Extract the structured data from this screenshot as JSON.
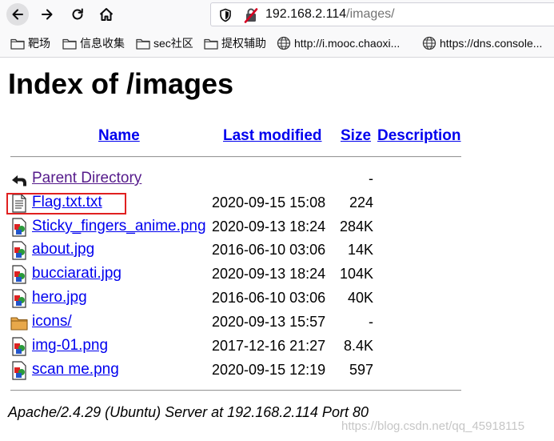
{
  "browser": {
    "address": {
      "host": "192.168.2.114",
      "path": "/images/"
    }
  },
  "bookmarks": [
    {
      "label": "靶场",
      "icon": "folder-icon"
    },
    {
      "label": "信息收集",
      "icon": "folder-icon"
    },
    {
      "label": "sec社区",
      "icon": "folder-icon"
    },
    {
      "label": "提权辅助",
      "icon": "folder-icon"
    },
    {
      "label": "http://i.mooc.chaoxi...",
      "icon": "globe-icon"
    },
    {
      "label": "https://dns.console...",
      "icon": "globe-icon"
    }
  ],
  "page": {
    "title": "Index of /images",
    "columns": {
      "name": "Name",
      "last_modified": "Last modified",
      "size": "Size",
      "description": "Description"
    },
    "entries": [
      {
        "name": "Parent Directory",
        "date": "",
        "size": "-",
        "icon": "back-arrow-icon"
      },
      {
        "name": "Flag.txt.txt",
        "date": "2020-09-15 15:08",
        "size": "224",
        "icon": "text-file-icon",
        "highlighted": true
      },
      {
        "name": "Sticky_fingers_anime.png",
        "date": "2020-09-13 18:24",
        "size": "284K",
        "icon": "image-file-icon"
      },
      {
        "name": "about.jpg",
        "date": "2016-06-10 03:06",
        "size": "14K",
        "icon": "image-file-icon"
      },
      {
        "name": "bucciarati.jpg",
        "date": "2020-09-13 18:24",
        "size": "104K",
        "icon": "image-file-icon"
      },
      {
        "name": "hero.jpg",
        "date": "2016-06-10 03:06",
        "size": "40K",
        "icon": "image-file-icon"
      },
      {
        "name": "icons/",
        "date": "2020-09-13 15:57",
        "size": "-",
        "icon": "folder-icon"
      },
      {
        "name": "img-01.png",
        "date": "2017-12-16 21:27",
        "size": "8.4K",
        "icon": "image-file-icon"
      },
      {
        "name": "scan me.png",
        "date": "2020-09-15 12:19",
        "size": "597",
        "icon": "image-file-icon"
      }
    ],
    "footer": "Apache/2.4.29 (Ubuntu) Server at 192.168.2.114 Port 80"
  },
  "watermark": "https://blog.csdn.net/qq_45918115",
  "colors": {
    "link": "#0000ee",
    "highlight_box": "#e02020"
  }
}
